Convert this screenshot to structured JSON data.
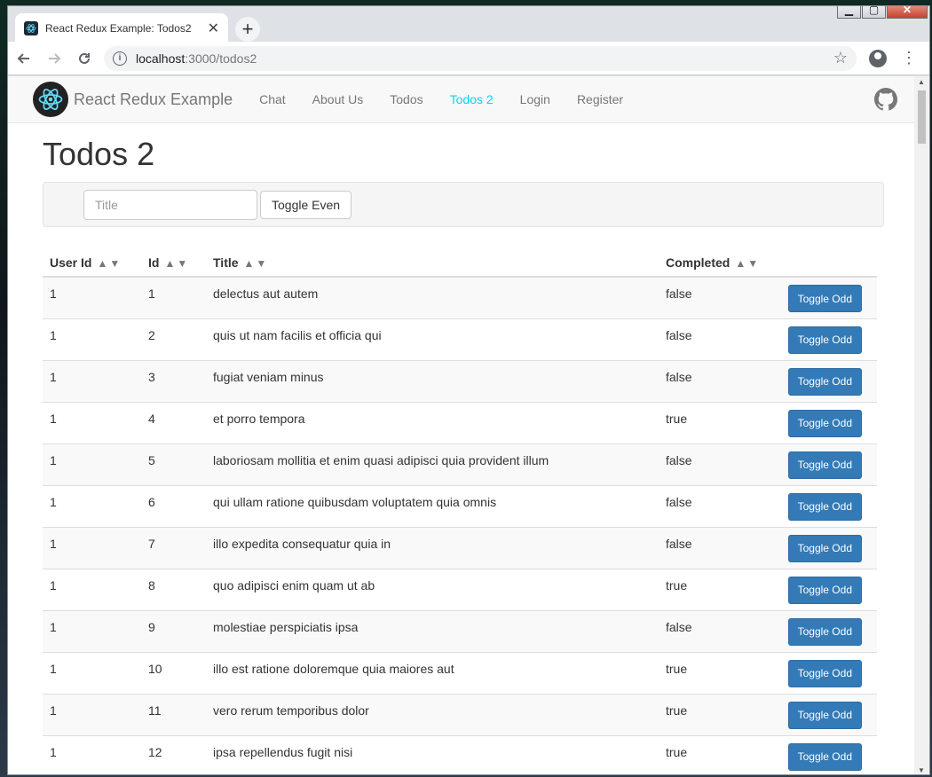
{
  "browser": {
    "tab_title": "React Redux Example: Todos2",
    "tab_close": "✕",
    "new_tab": "+",
    "url_host": "localhost",
    "url_path": ":3000/todos2"
  },
  "app": {
    "brand": "React Redux Example",
    "nav": [
      "Chat",
      "About Us",
      "Todos",
      "Todos 2",
      "Login",
      "Register"
    ],
    "active_nav": "Todos 2"
  },
  "page": {
    "title": "Todos 2",
    "filter": {
      "placeholder": "Title",
      "toggle_even_label": "Toggle Even"
    }
  },
  "table": {
    "columns": [
      "User Id",
      "Id",
      "Title",
      "Completed"
    ],
    "row_button": "Toggle Odd",
    "rows": [
      {
        "userId": "1",
        "id": "1",
        "title": "delectus aut autem",
        "completed": "false"
      },
      {
        "userId": "1",
        "id": "2",
        "title": "quis ut nam facilis et officia qui",
        "completed": "false"
      },
      {
        "userId": "1",
        "id": "3",
        "title": "fugiat veniam minus",
        "completed": "false"
      },
      {
        "userId": "1",
        "id": "4",
        "title": "et porro tempora",
        "completed": "true"
      },
      {
        "userId": "1",
        "id": "5",
        "title": "laboriosam mollitia et enim quasi adipisci quia provident illum",
        "completed": "false"
      },
      {
        "userId": "1",
        "id": "6",
        "title": "qui ullam ratione quibusdam voluptatem quia omnis",
        "completed": "false"
      },
      {
        "userId": "1",
        "id": "7",
        "title": "illo expedita consequatur quia in",
        "completed": "false"
      },
      {
        "userId": "1",
        "id": "8",
        "title": "quo adipisci enim quam ut ab",
        "completed": "true"
      },
      {
        "userId": "1",
        "id": "9",
        "title": "molestiae perspiciatis ipsa",
        "completed": "false"
      },
      {
        "userId": "1",
        "id": "10",
        "title": "illo est ratione doloremque quia maiores aut",
        "completed": "true"
      },
      {
        "userId": "1",
        "id": "11",
        "title": "vero rerum temporibus dolor",
        "completed": "true"
      },
      {
        "userId": "1",
        "id": "12",
        "title": "ipsa repellendus fugit nisi",
        "completed": "true"
      }
    ]
  },
  "colors": {
    "active_nav": "#00d8ff",
    "primary_button": "#337ab7"
  }
}
